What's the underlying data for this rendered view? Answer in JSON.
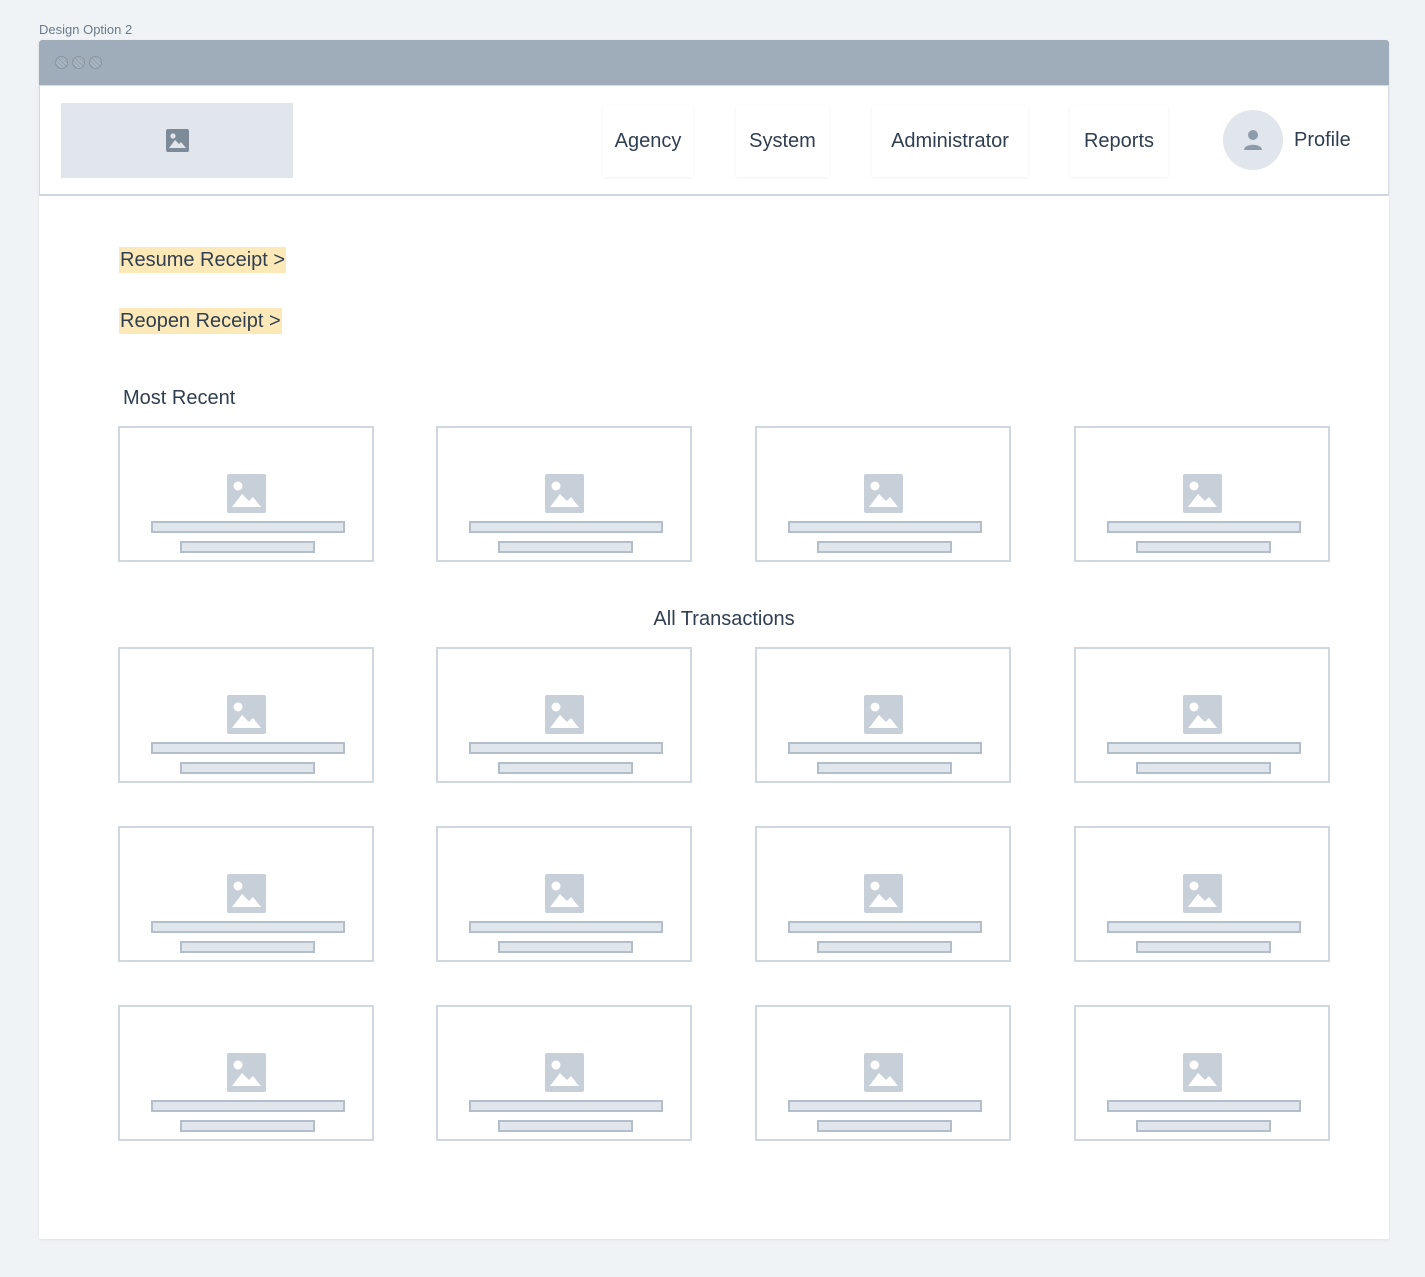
{
  "frame_label": "Design Option 2",
  "window": {
    "dots": [
      "window-dot",
      "window-dot",
      "window-dot"
    ]
  },
  "nav": {
    "logo_icon": "image-placeholder-icon",
    "items": [
      {
        "label": "Agency"
      },
      {
        "label": "System"
      },
      {
        "label": "Administrator"
      },
      {
        "label": "Reports"
      }
    ],
    "profile": {
      "label": "Profile",
      "icon": "user-icon"
    }
  },
  "links": {
    "resume": "Resume Receipt >",
    "reopen": "Reopen Receipt >"
  },
  "sections": {
    "most_recent": {
      "title": "Most Recent",
      "card_count": 4
    },
    "all_transactions": {
      "title": "All Transactions",
      "card_count": 12
    }
  },
  "colors": {
    "link_highlight": "#fde9b8",
    "titlebar": "#9eadb9",
    "placeholder": "#e1e6ec",
    "placeholder_icon": "#c7d0d9"
  }
}
